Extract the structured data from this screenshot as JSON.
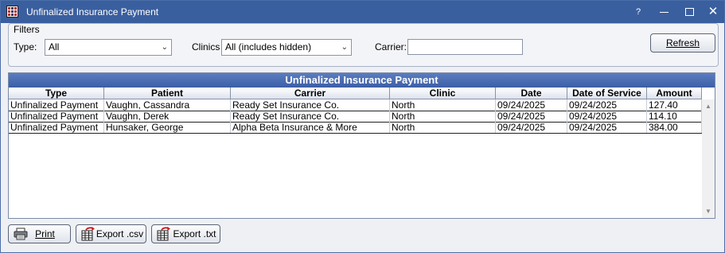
{
  "window": {
    "title": "Unfinalized Insurance Payment"
  },
  "titlebar": {
    "help": "?",
    "minimize": "",
    "maximize": "",
    "close": "✕"
  },
  "filters": {
    "legend": "Filters",
    "type_label": "Type:",
    "type_value": "All",
    "clinics_label": "Clinics",
    "clinics_value": "All (includes hidden)",
    "carrier_label": "Carrier:",
    "carrier_value": "",
    "refresh_label": "Refresh"
  },
  "grid": {
    "title": "Unfinalized Insurance Payment",
    "columns": [
      "Type",
      "Patient",
      "Carrier",
      "Clinic",
      "Date",
      "Date of Service",
      "Amount"
    ],
    "rows": [
      [
        "Unfinalized Payment",
        "Vaughn, Cassandra",
        "Ready Set Insurance Co.",
        "North",
        "09/24/2025",
        "09/24/2025",
        "127.40"
      ],
      [
        "Unfinalized Payment",
        "Vaughn, Derek",
        "Ready Set Insurance Co.",
        "North",
        "09/24/2025",
        "09/24/2025",
        "114.10"
      ],
      [
        "Unfinalized Payment",
        "Hunsaker, George",
        "Alpha Beta Insurance & More",
        "North",
        "09/24/2025",
        "09/24/2025",
        "384.00"
      ]
    ]
  },
  "bottom": {
    "print_label": "Print",
    "export_csv_label": "Export .csv",
    "export_txt_label": "Export .txt"
  },
  "icons": {
    "app": "grid-app-icon",
    "print": "printer-icon",
    "export": "spreadsheet-export-icon"
  },
  "colors": {
    "titlebar": "#3a5f9f",
    "grid_header": "#4a6cb0"
  }
}
